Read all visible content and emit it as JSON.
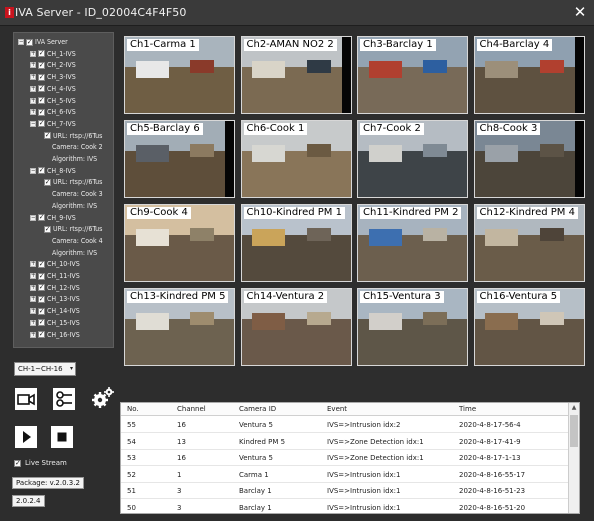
{
  "window": {
    "title": "IVA Server - ID_02004C4F4F50",
    "app_icon": "i",
    "close_icon": "✕"
  },
  "tree": {
    "root": "IVA Server",
    "rows": [
      {
        "depth": 0,
        "pm": "−",
        "checked": true,
        "label": "IVA Server"
      },
      {
        "depth": 1,
        "pm": "+",
        "checked": true,
        "label": "CH_1-IVS"
      },
      {
        "depth": 1,
        "pm": "+",
        "checked": true,
        "label": "CH_2-IVS"
      },
      {
        "depth": 1,
        "pm": "+",
        "checked": true,
        "label": "CH_3-IVS"
      },
      {
        "depth": 1,
        "pm": "+",
        "checked": true,
        "label": "CH_4-IVS"
      },
      {
        "depth": 1,
        "pm": "+",
        "checked": true,
        "label": "CH_5-IVS"
      },
      {
        "depth": 1,
        "pm": "+",
        "checked": true,
        "label": "CH_6-IVS"
      },
      {
        "depth": 1,
        "pm": "−",
        "checked": true,
        "label": "CH_7-IVS"
      },
      {
        "depth": 2,
        "pm": "",
        "checked": true,
        "label": "URL: rtsp://6Tus"
      },
      {
        "depth": 3,
        "pm": "",
        "checked": null,
        "label": "Camera: Cook 2"
      },
      {
        "depth": 3,
        "pm": "",
        "checked": null,
        "label": "Algorithm: IVS"
      },
      {
        "depth": 1,
        "pm": "−",
        "checked": true,
        "label": "CH_8-IVS"
      },
      {
        "depth": 2,
        "pm": "",
        "checked": true,
        "label": "URL: rtsp://6Tus"
      },
      {
        "depth": 3,
        "pm": "",
        "checked": null,
        "label": "Camera: Cook 3"
      },
      {
        "depth": 3,
        "pm": "",
        "checked": null,
        "label": "Algorithm: IVS"
      },
      {
        "depth": 1,
        "pm": "−",
        "checked": true,
        "label": "CH_9-IVS"
      },
      {
        "depth": 2,
        "pm": "",
        "checked": true,
        "label": "URL: rtsp://6Tus"
      },
      {
        "depth": 3,
        "pm": "",
        "checked": null,
        "label": "Camera: Cook 4"
      },
      {
        "depth": 3,
        "pm": "",
        "checked": null,
        "label": "Algorithm: IVS"
      },
      {
        "depth": 1,
        "pm": "+",
        "checked": true,
        "label": "CH_10-IVS"
      },
      {
        "depth": 1,
        "pm": "+",
        "checked": true,
        "label": "CH_11-IVS"
      },
      {
        "depth": 1,
        "pm": "+",
        "checked": true,
        "label": "CH_12-IVS"
      },
      {
        "depth": 1,
        "pm": "+",
        "checked": true,
        "label": "CH_13-IVS"
      },
      {
        "depth": 1,
        "pm": "+",
        "checked": true,
        "label": "CH_14-IVS"
      },
      {
        "depth": 1,
        "pm": "+",
        "checked": true,
        "label": "CH_15-IVS"
      },
      {
        "depth": 1,
        "pm": "+",
        "checked": true,
        "label": "CH_16-IVS"
      }
    ]
  },
  "channel_select": {
    "value": "CH-1~CH-16",
    "arrow_icon": "▾"
  },
  "controls": {
    "record_icon": "camera-record-icon",
    "settings_icon": "flow-settings-icon",
    "gear_icon": "gears-icon",
    "play_icon": "play-icon",
    "stop_icon": "stop-icon"
  },
  "live_stream": {
    "label": "Live Stream",
    "checked": true
  },
  "package": {
    "label": "Package: v.2.0.3.2"
  },
  "version": {
    "label": "2.0.2.4"
  },
  "cameras": [
    {
      "label": "Ch1-Carma 1",
      "sky": "#a9b4bd",
      "ground": "#6f5e44",
      "b1": "#e8e8e8",
      "b2": "#8a3a2a",
      "bar": false
    },
    {
      "label": "Ch2-AMAN NO2 2",
      "sky": "#bfc3c6",
      "ground": "#7b6a52",
      "b1": "#d9d4c8",
      "b2": "#2f3a45",
      "bar": true
    },
    {
      "label": "Ch3-Barclay 1",
      "sky": "#93a3b2",
      "ground": "#786a58",
      "b1": "#b04030",
      "b2": "#2d5fa0",
      "bar": false
    },
    {
      "label": "Ch4-Barclay 4",
      "sky": "#8fa0b0",
      "ground": "#5e5140",
      "b1": "#9c8f7a",
      "b2": "#b1402f",
      "bar": true
    },
    {
      "label": "Ch5-Barclay 6",
      "sky": "#a2adb6",
      "ground": "#5e4e3a",
      "b1": "#5a5f66",
      "b2": "#8c7a60",
      "bar": true
    },
    {
      "label": "Ch6-Cook 1",
      "sky": "#c7cacb",
      "ground": "#897559",
      "b1": "#d7d7d2",
      "b2": "#6b5a42",
      "bar": false
    },
    {
      "label": "Ch7-Cook 2",
      "sky": "#b5bcc3",
      "ground": "#3e4448",
      "b1": "#d0d0cc",
      "b2": "#7f8a94",
      "bar": false
    },
    {
      "label": "Ch8-Cook 3",
      "sky": "#7a8794",
      "ground": "#4c453a",
      "b1": "#9aa1a8",
      "b2": "#5c5346",
      "bar": true
    },
    {
      "label": "Ch9-Cook 4",
      "sky": "#d4bfa0",
      "ground": "#6a5a48",
      "b1": "#e7e1d5",
      "b2": "#8e8168",
      "bar": false
    },
    {
      "label": "Ch10-Kindred PM 1",
      "sky": "#b9c2cc",
      "ground": "#544a3d",
      "b1": "#caa45a",
      "b2": "#6e6458",
      "bar": false
    },
    {
      "label": "Ch11-Kindred PM 2",
      "sky": "#a7b3bf",
      "ground": "#6c5f4e",
      "b1": "#3d6fb0",
      "b2": "#b9b2a3",
      "bar": false
    },
    {
      "label": "Ch12-Kindred PM 4",
      "sky": "#b0b8bf",
      "ground": "#6a5c49",
      "b1": "#c2b6a0",
      "b2": "#4e4439",
      "bar": false
    },
    {
      "label": "Ch13-Kindred PM 5",
      "sky": "#b8c0c8",
      "ground": "#6d6250",
      "b1": "#e0ddd5",
      "b2": "#9e8c6e",
      "bar": false
    },
    {
      "label": "Ch14-Ventura 2",
      "sky": "#c5c8ca",
      "ground": "#6a594a",
      "b1": "#7f5d45",
      "b2": "#b7a98f",
      "bar": false
    },
    {
      "label": "Ch15-Ventura 3",
      "sky": "#a9b6c2",
      "ground": "#5e5648",
      "b1": "#d2cfca",
      "b2": "#7c6e58",
      "bar": false
    },
    {
      "label": "Ch16-Ventura 5",
      "sky": "#b6bfc7",
      "ground": "#625545",
      "b1": "#8a6d4f",
      "b2": "#cfc6b7",
      "bar": false
    }
  ],
  "events_table": {
    "columns": [
      "No.",
      "Channel",
      "Camera ID",
      "Event",
      "Time"
    ],
    "rows": [
      [
        "55",
        "16",
        "Ventura 5",
        "IVS=>Intrusion idx:2",
        "2020-4-8-17-56-4"
      ],
      [
        "54",
        "13",
        "Kindred PM 5",
        "IVS=>Zone Detection idx:1",
        "2020-4-8-17-41-9"
      ],
      [
        "53",
        "16",
        "Ventura 5",
        "IVS=>Zone Detection idx:1",
        "2020-4-8-17-1-13"
      ],
      [
        "52",
        "1",
        "Carma 1",
        "IVS=>Intrusion idx:1",
        "2020-4-8-16-55-17"
      ],
      [
        "51",
        "3",
        "Barclay 1",
        "IVS=>Intrusion idx:1",
        "2020-4-8-16-51-23"
      ],
      [
        "50",
        "3",
        "Barclay 1",
        "IVS=>Intrusion idx:1",
        "2020-4-8-16-51-20"
      ]
    ],
    "scroll_up_icon": "▲"
  }
}
